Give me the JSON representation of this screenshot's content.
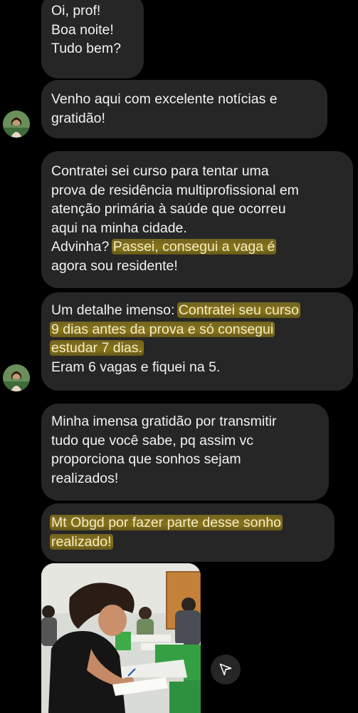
{
  "messages": [
    {
      "lines": [
        "Oi, prof!",
        "Boa noite!",
        "Tudo bem?"
      ]
    },
    {
      "lines": [
        "Venho aqui com excelente notícias e",
        "gratidão!"
      ]
    },
    {
      "lines": [
        "Contratei sei curso para tentar uma",
        "prova de residência multiprofissional em",
        "atenção primária à saúde que ocorreu",
        "aqui na minha cidade."
      ],
      "line5_plain": "Advinha? ",
      "line5_hl": "Passei, consegui a vaga é",
      "line6": "agora sou residente!"
    },
    {
      "l1_plain": "Um detalhe imenso: ",
      "l1_hl": "Contratei seu curso",
      "l2_hl": "9 dias antes da prova e só consegui",
      "l3_hl": "estudar 7 dias.",
      "l4": "Eram 6 vagas e fiquei na 5."
    },
    {
      "lines": [
        "Minha imensa gratidão por transmitir",
        "tudo que você sabe, pq assim vc",
        "proporciona que sonhos sejam",
        "realizados!"
      ]
    },
    {
      "l1_hl": "Mt Obgd por fazer parte desse sonho",
      "l2_hl": "realizado!"
    }
  ],
  "colors": {
    "background": "#000000",
    "bubble": "#262626",
    "text": "#f2f2f2",
    "highlight": "#a88e14"
  },
  "icons": {
    "avatar": "profile-avatar",
    "share": "send-icon"
  }
}
